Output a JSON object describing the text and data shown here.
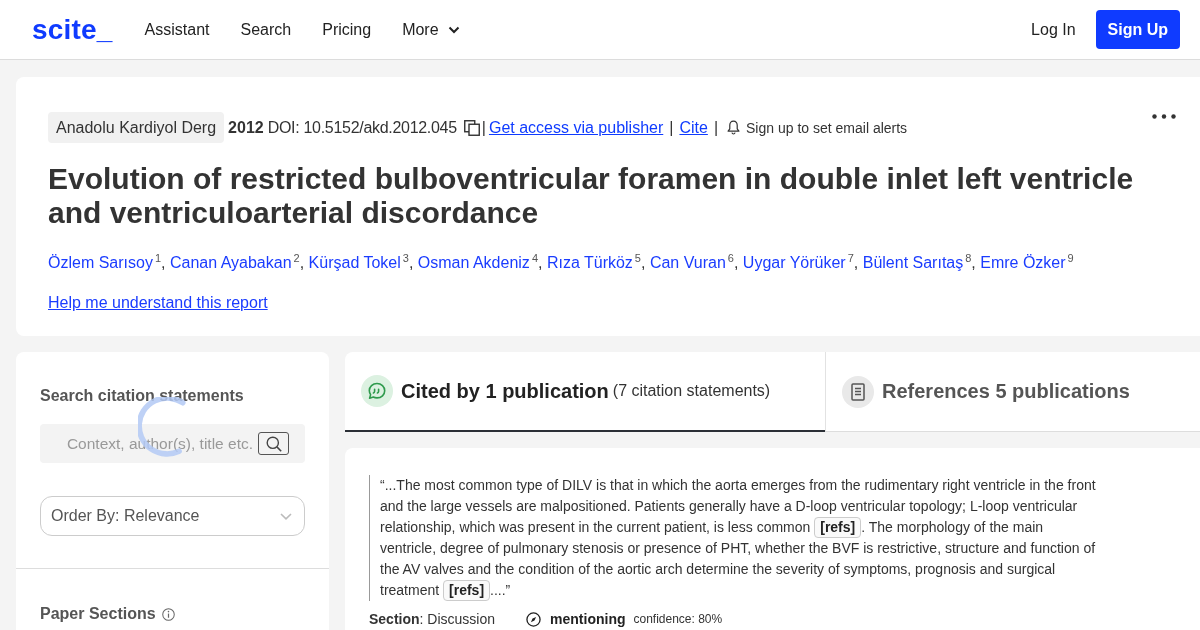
{
  "header": {
    "logo": "scite_",
    "nav": [
      {
        "label": "Assistant",
        "kind": "link"
      },
      {
        "label": "Search",
        "kind": "link"
      },
      {
        "label": "Pricing",
        "kind": "link"
      },
      {
        "label": "More",
        "kind": "menu"
      }
    ],
    "log_in": "Log In",
    "sign_up": "Sign Up"
  },
  "report": {
    "journal": "Anadolu Kardiyol Derg",
    "year": "2012",
    "doi": "DOI: 10.5152/akd.2012.045",
    "meta_items": [
      {
        "kind": "separator",
        "text": "|"
      },
      {
        "kind": "link",
        "text": "Get access via publisher"
      },
      {
        "kind": "separator",
        "text": "|"
      },
      {
        "kind": "link",
        "text": "Cite"
      },
      {
        "kind": "separator",
        "text": "|"
      },
      {
        "kind": "alert",
        "text": "Sign up to set email alerts"
      }
    ],
    "title": "Evolution of restricted bulboventricular foramen in double inlet left ventricle and ventriculoarterial discordance",
    "authors": [
      {
        "name": "Özlem Sarısoy",
        "sup": "1",
        "after": ","
      },
      {
        "name": "Canan Ayabakan",
        "sup": "2",
        "after": ","
      },
      {
        "name": "Kürşad Tokel",
        "sup": "3",
        "after": ","
      },
      {
        "name": "Osman Akdeniz",
        "sup": "4",
        "after": ","
      },
      {
        "name": "Rıza Türköz",
        "sup": "5",
        "after": ","
      },
      {
        "name": "Can Vuran",
        "sup": "6",
        "after": ","
      },
      {
        "name": "Uygar Yörüker",
        "sup": "7",
        "after": ","
      },
      {
        "name": "Bülent Sarıtaş",
        "sup": "8",
        "after": ","
      },
      {
        "name": "Emre Özker",
        "sup": "9"
      }
    ],
    "help_link": "Help me understand this report"
  },
  "sidebar": {
    "search_title": "Search citation statements",
    "search": {
      "placeholder": "Context, author(s), title etc."
    },
    "order_by": {
      "value": "Order By: Relevance"
    },
    "sections_title": "Paper Sections",
    "loading": true
  },
  "tabs": [
    {
      "kind": "citing",
      "label": "Cited by 1 publication",
      "detail": "(7 citation statements)",
      "selected": true
    },
    {
      "kind": "references",
      "label": "References 5 publications",
      "selected": false
    }
  ],
  "citations": [
    {
      "quote": [
        {
          "kind": "text",
          "text": "“...The most common type of DILV is that in which the aorta emerges from the rudimentary right ventricle in the front and the large vessels are malpositioned. Patients generally have a D-loop ventricular topology; L-loop ventricular relationship, which was present in the current patient, is less common "
        },
        {
          "kind": "ref",
          "text": "[refs]"
        },
        {
          "kind": "text",
          "text": ". The morphology of the main ventricle, degree of pulmonary stenosis or presence of PHT, whether the BVF is restrictive, structure and function of the AV valves and the condition of the aortic arch determine the severity of symptoms, prognosis and surgical treatment "
        },
        {
          "kind": "ref",
          "text": "[refs]"
        },
        {
          "kind": "text",
          "text": "....”"
        }
      ],
      "section": "**Section**: Discussion",
      "classification": "mentioning",
      "confidence": "confidence: 80%"
    }
  ]
}
